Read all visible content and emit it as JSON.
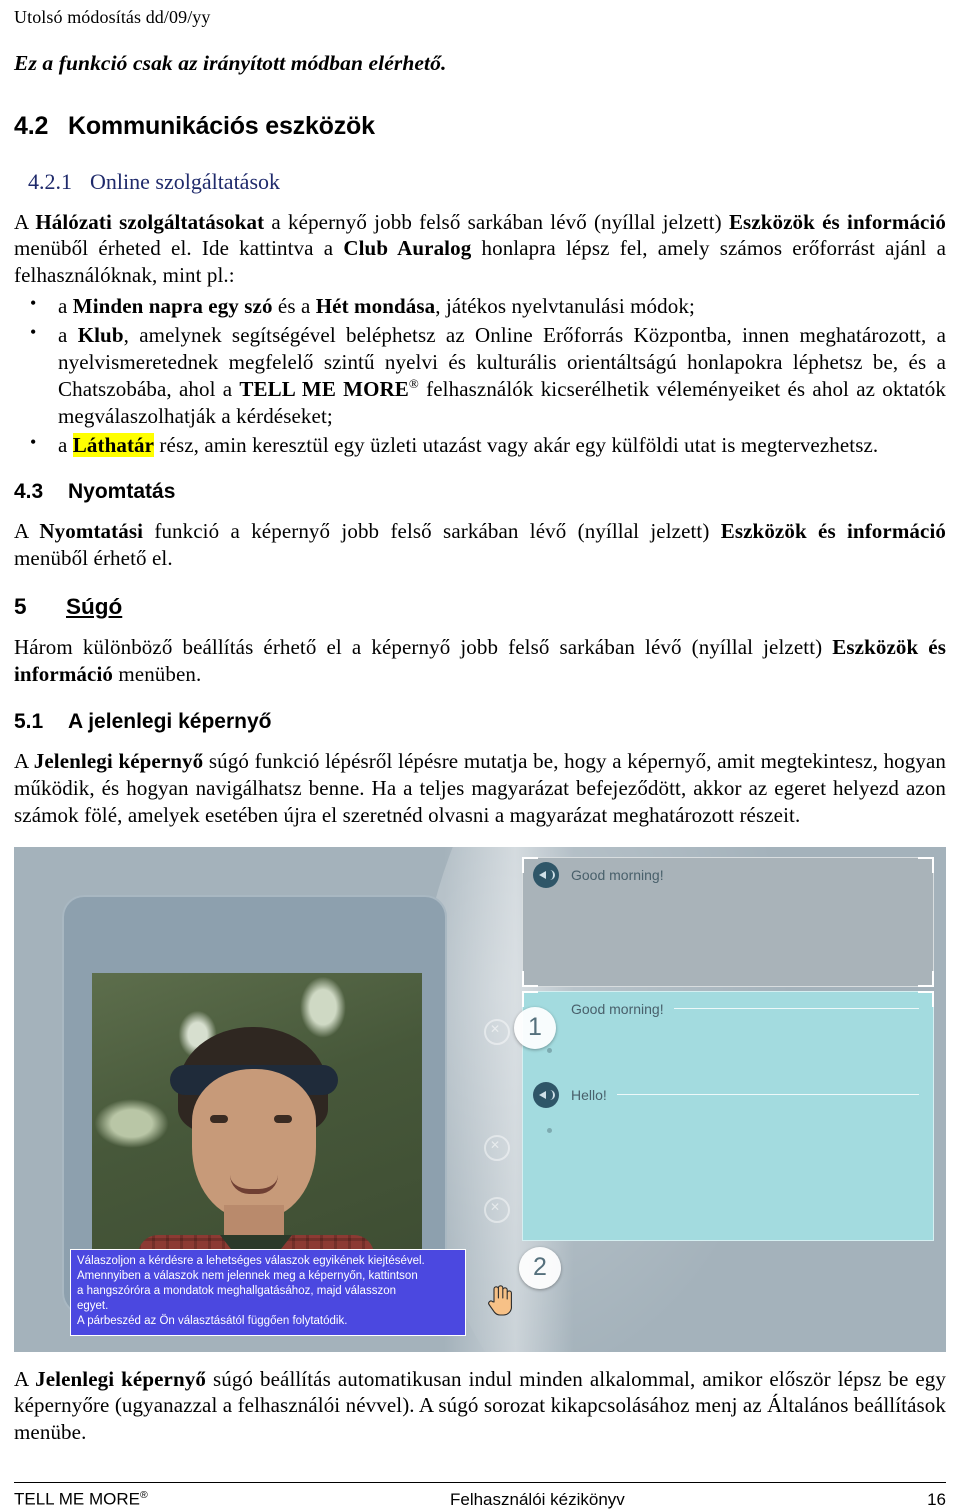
{
  "header": {
    "revision": "Utolsó módosítás dd/09/yy"
  },
  "notice": "Ez a funkció csak az irányított módban elérhető.",
  "sections": {
    "s42": {
      "num": "4.2",
      "title": "Kommunikációs eszközök"
    },
    "s421": {
      "num": "4.2.1",
      "title": "Online szolgáltatások"
    },
    "s43": {
      "num": "4.3",
      "title": "Nyomtatás"
    },
    "s5": {
      "num": "5",
      "title": "Súgó"
    },
    "s51": {
      "num": "5.1",
      "title": "A jelenlegi képernyő"
    }
  },
  "p421": {
    "a": "A ",
    "b1": "Hálózati szolgáltatásokat",
    "c": " a képernyő jobb felső sarkában lévő (nyíllal jelzett) ",
    "b2": "Eszközök és információ",
    "d": " menüből érheted el. Ide kattintva a ",
    "b3": "Club Auralog",
    "e": " honlapra lépsz fel, amely számos erőforrást ajánl a felhasználóknak, mint pl.:"
  },
  "bullets": [
    {
      "pre": "a ",
      "bold1": "Minden napra egy szó",
      "mid": " és a ",
      "bold2": "Hét mondása",
      "post": ", játékos nyelvtanulási módok;"
    },
    {
      "pre": "a ",
      "bold1": "Klub",
      "mid": ", amelynek segítségével beléphetsz az Online Erőforrás Központba, innen meghatározott, a nyelvismeretednek megfelelő szintű nyelvi és kulturális orientáltságú honlapokra léphetsz be, és a Chatszobába, ahol a ",
      "bold2": "TELL ME MORE",
      "reg": "®",
      "post": " felhasználók kicserélhetik véleményeiket és ahol az oktatók megválaszolhatják a kérdéseket;"
    },
    {
      "pre": "a ",
      "highlight": "Láthatár",
      "post": " rész, amin keresztül egy üzleti utazást vagy akár egy külföldi utat is megtervezhetsz."
    }
  ],
  "p43": {
    "a": "A ",
    "b1": "Nyomtatási",
    "c": " funkció a képernyő jobb felső sarkában lévő (nyíllal jelzett) ",
    "b2": "Eszközök és információ",
    "d": " menüből érhető el."
  },
  "p5": {
    "a": "Három különböző beállítás érhető el a képernyő jobb felső sarkában lévő (nyíllal jelzett) ",
    "b1": "Eszközök és információ",
    "c": " menüben."
  },
  "p51": {
    "a": "A ",
    "b1": "Jelenlegi képernyő",
    "c": " súgó funkció lépésről lépésre mutatja be, hogy a képernyő, amit megtekintesz, hogyan működik, és hogyan navigálhatsz benne. Ha a teljes magyarázat befejeződött, akkor az egeret helyezd azon számok fölé, amelyek esetében újra el szeretnéd olvasni a magyarázat meghatározott részeit."
  },
  "p51b": {
    "a": "A ",
    "b1": "Jelenlegi képernyő",
    "c": " súgó beállítás automatikusan indul minden alkalommal, amikor először lépsz be egy képernyőre (ugyanazzal a felhasználói névvel). A súgó sorozat kikapcsolásához menj az Általános beállítások menübe."
  },
  "screenshot": {
    "dialog_top": "Good morning!",
    "dialog_mid": "Good morning!",
    "dialog_bottom": "Hello!",
    "badge_1": "1",
    "badge_2": "2",
    "tooltip_lines": [
      "Válaszoljon a kérdésre a lehetséges válaszok egyikének kiejtésével.",
      "Amennyiben a válaszok nem jelennek meg a képernyőn, kattintson",
      "a hangszóróra a mondatok meghallgatásához, majd válasszon",
      "egyet.",
      "A párbeszéd az Ön választásától függően folytatódik."
    ]
  },
  "footer": {
    "left": "TELL ME MORE",
    "left_reg": "®",
    "center": "Felhasználói kézikönyv",
    "page": "16"
  },
  "colors": {
    "heading_blue": "#1f2a6b",
    "highlight_yellow": "#ffff00",
    "shot_background": "#a4b2bb",
    "tooltip_blue": "#4b48e0",
    "dialog_cyan": "#a3dbdf",
    "dialog_grey": "#a9b3b9"
  }
}
